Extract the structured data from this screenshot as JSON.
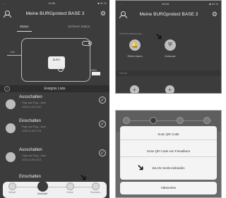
{
  "app": {
    "title": "Meine BURGprotect BASE 3"
  },
  "phone_a": {
    "statusbar": {
      "carrier": "…",
      "time": "10:00",
      "battery": "■ 31 %"
    },
    "tabs": [
      "Status",
      "Sicherer Status"
    ],
    "house": {
      "wifi_label": "LAN",
      "hub_label": "BURG",
      "battery_label": "100%"
    },
    "events_header": "Ereignis Liste",
    "events": [
      {
        "title": "Ausschalten",
        "line1": "Fuge aus Plug – oben",
        "line2": "2018-11-08 13:10"
      },
      {
        "title": "Einschalten",
        "line1": "Fuge aus Plug – oben",
        "line2": "2018-11-08 17:04"
      },
      {
        "title": "Ausschalten",
        "line1": "Fuge aus Plug – oben",
        "line2": "2018-11-08 10:03"
      },
      {
        "title": "Einschalten",
        "line1": "",
        "line2": ""
      }
    ],
    "nav": [
      "Scharf",
      "Unscharf",
      "Home",
      "Szenario"
    ]
  },
  "phone_b": {
    "statusbar": {
      "carrier": "…",
      "time": "09:54",
      "battery": "■ 31 %"
    },
    "caption": "Sicherheitsmodus",
    "modes": [
      {
        "label": "Silent Alarm",
        "icon": "bell-icon"
      },
      {
        "label": "Zuhause",
        "icon": "shield-icon"
      }
    ],
    "divider": "Szene"
  },
  "phone_c": {
    "top_labels": [
      "Scharf",
      "Unscharf",
      "Home"
    ],
    "options": [
      "Scan QR Code",
      "Scan QR Code von Fotoalbum",
      "WLAN Gerät einbinden"
    ],
    "cancel": "Abbrechen"
  },
  "colors": {
    "phone_bg": "#3c3c3c",
    "nav_bg": "#f0f0f0",
    "sheet_bg": "#f4f4f4"
  }
}
